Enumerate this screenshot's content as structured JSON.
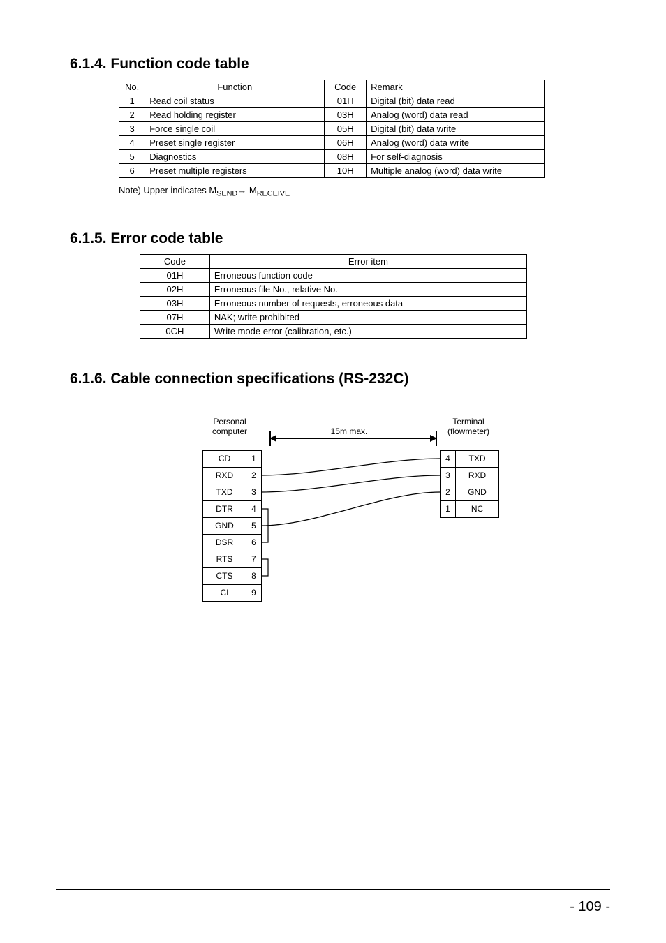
{
  "sections": {
    "s614": "6.1.4. Function code table",
    "s615": "6.1.5. Error code table",
    "s616": "6.1.6. Cable connection specifications (RS-232C)"
  },
  "func_table": {
    "headers": [
      "No.",
      "Function",
      "Code",
      "Remark"
    ],
    "rows": [
      [
        "1",
        "Read coil status",
        "01H",
        "Digital (bit) data read"
      ],
      [
        "2",
        "Read holding register",
        "03H",
        "Analog (word) data read"
      ],
      [
        "3",
        "Force single coil",
        "05H",
        "Digital (bit) data write"
      ],
      [
        "4",
        "Preset single register",
        "06H",
        "Analog (word) data write"
      ],
      [
        "5",
        "Diagnostics",
        "08H",
        "For self-diagnosis"
      ],
      [
        "6",
        "Preset multiple registers",
        "10H",
        "Multiple analog (word) data write"
      ]
    ]
  },
  "note": {
    "prefix": "Note) Upper indicates M",
    "sub1": "SEND",
    "mid": " → M",
    "sub2": "RECEIVE"
  },
  "err_table": {
    "headers": [
      "Code",
      "Error item"
    ],
    "rows": [
      [
        "01H",
        "Erroneous function code"
      ],
      [
        "02H",
        "Erroneous file No., relative No."
      ],
      [
        "03H",
        "Erroneous number of requests, erroneous data"
      ],
      [
        "07H",
        "NAK; write prohibited"
      ],
      [
        "0CH",
        "Write mode error (calibration, etc.)"
      ]
    ]
  },
  "diagram": {
    "label_pc": "Personal computer",
    "label_ter": "Terminal (flowmeter)",
    "label_len": "15m max.",
    "pc_pins": [
      [
        "CD",
        "1"
      ],
      [
        "RXD",
        "2"
      ],
      [
        "TXD",
        "3"
      ],
      [
        "DTR",
        "4"
      ],
      [
        "GND",
        "5"
      ],
      [
        "DSR",
        "6"
      ],
      [
        "RTS",
        "7"
      ],
      [
        "CTS",
        "8"
      ],
      [
        "CI",
        "9"
      ]
    ],
    "ter_pins": [
      [
        "4",
        "TXD"
      ],
      [
        "3",
        "RXD"
      ],
      [
        "2",
        "GND"
      ],
      [
        "1",
        "NC"
      ]
    ]
  },
  "page_number": "- 109 -"
}
